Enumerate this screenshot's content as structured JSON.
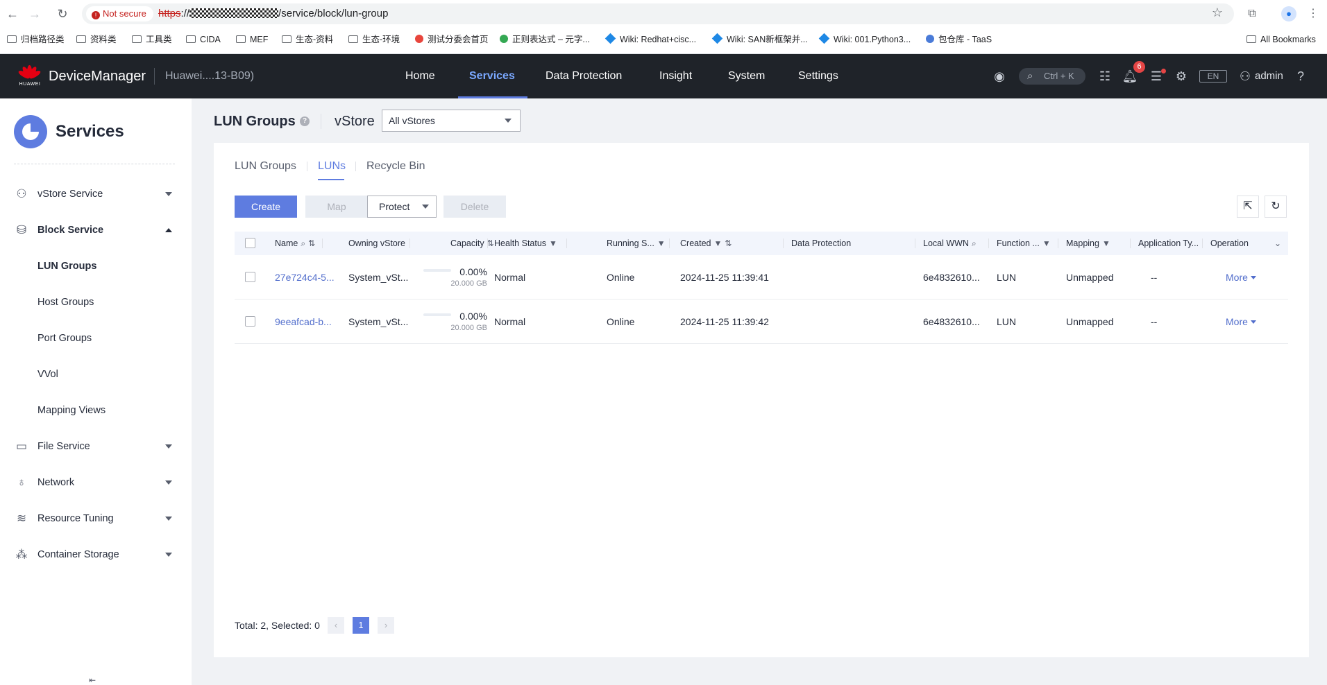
{
  "browser": {
    "not_secure": "Not secure",
    "url_proto": "https",
    "url_sep": "://",
    "url_path": "/service/block/lun-group",
    "bookmarks": [
      "归档路径类",
      "资料类",
      "工具类",
      "CIDA",
      "MEF",
      "生态-资料",
      "生态-环境",
      "测试分委会首页",
      "正则表达式 – 元字...",
      "Wiki: Redhat+cisc...",
      "Wiki: SAN新框架并...",
      "Wiki: 001.Python3...",
      "包仓库 - TaaS"
    ],
    "all_bookmarks": "All Bookmarks"
  },
  "header": {
    "brand": "HUAWEI",
    "app_name": "DeviceManager",
    "device": "Huawei....13-B09)",
    "nav": [
      "Home",
      "Services",
      "Data Protection",
      "Insight",
      "System",
      "Settings"
    ],
    "search_hint": "Ctrl + K",
    "notifications": "6",
    "lang": "EN",
    "user": "admin"
  },
  "sidebar": {
    "title": "Services",
    "items": [
      {
        "label": "vStore Service"
      },
      {
        "label": "Block Service"
      },
      {
        "label": "File Service"
      },
      {
        "label": "Network"
      },
      {
        "label": "Resource Tuning"
      },
      {
        "label": "Container Storage"
      }
    ],
    "block_sub": [
      "LUN Groups",
      "Host Groups",
      "Port Groups",
      "VVol",
      "Mapping Views"
    ]
  },
  "page": {
    "title": "LUN Groups",
    "vstore_label": "vStore",
    "vstore_value": "All vStores",
    "tabs": [
      "LUN Groups",
      "LUNs",
      "Recycle Bin"
    ],
    "buttons": {
      "create": "Create",
      "map": "Map",
      "protect": "Protect",
      "delete": "Delete"
    }
  },
  "table": {
    "columns": [
      "Name",
      "Owning vStore",
      "Capacity",
      "Health Status",
      "Running S...",
      "Created",
      "Data Protection",
      "Local WWN",
      "Function ...",
      "Mapping",
      "Application Ty...",
      "Operation"
    ],
    "rows": [
      {
        "name": "27e724c4-5...",
        "vstore": "System_vSt...",
        "cap_pct": "0.00%",
        "cap_size": "20.000 GB",
        "health": "Normal",
        "running": "Online",
        "created": "2024-11-25 11:39:41",
        "wwn": "6e4832610...",
        "function": "LUN",
        "mapping": "Unmapped",
        "app": "--",
        "op": "More"
      },
      {
        "name": "9eeafcad-b...",
        "vstore": "System_vSt...",
        "cap_pct": "0.00%",
        "cap_size": "20.000 GB",
        "health": "Normal",
        "running": "Online",
        "created": "2024-11-25 11:39:42",
        "wwn": "6e4832610...",
        "function": "LUN",
        "mapping": "Unmapped",
        "app": "--",
        "op": "More"
      }
    ]
  },
  "footer": {
    "total": "Total: 2, Selected: 0",
    "page": "1"
  },
  "colors": {
    "accent": "#5e7ce0",
    "header_bg": "#1f2329",
    "link": "#526ecc"
  }
}
